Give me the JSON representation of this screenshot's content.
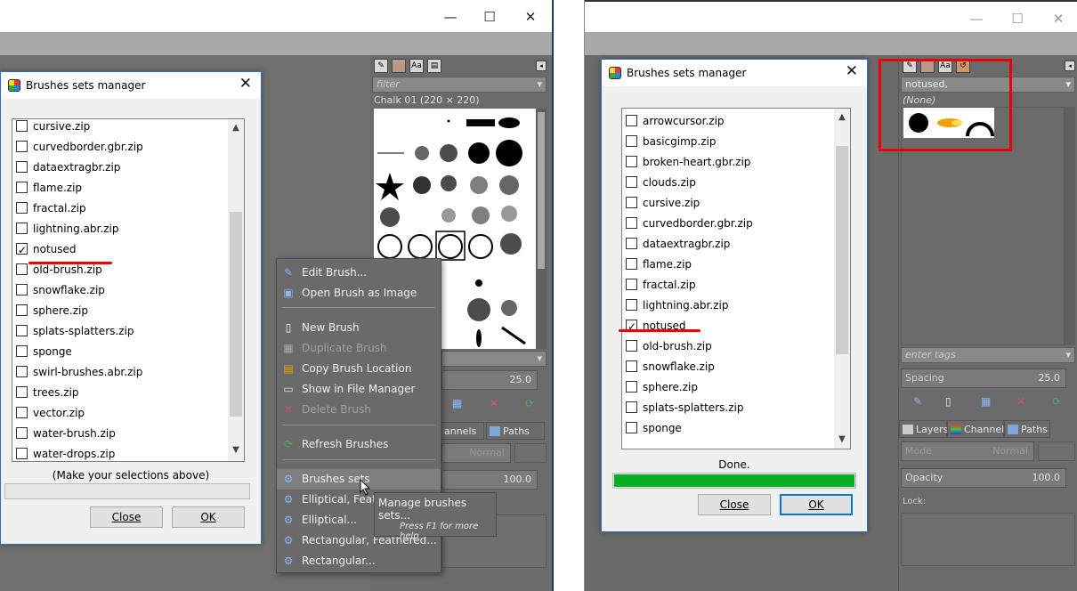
{
  "left": {
    "dialog": {
      "title": "Brushes sets manager",
      "items": [
        {
          "label": "cursive.zip",
          "checked": false
        },
        {
          "label": "curvedborder.gbr.zip",
          "checked": false
        },
        {
          "label": "dataextragbr.zip",
          "checked": false
        },
        {
          "label": "flame.zip",
          "checked": false
        },
        {
          "label": "fractal.zip",
          "checked": false
        },
        {
          "label": "lightning.abr.zip",
          "checked": false
        },
        {
          "label": "notused",
          "checked": true
        },
        {
          "label": "old-brush.zip",
          "checked": false
        },
        {
          "label": "snowflake.zip",
          "checked": false
        },
        {
          "label": "sphere.zip",
          "checked": false
        },
        {
          "label": "splats-splatters.zip",
          "checked": false
        },
        {
          "label": "sponge",
          "checked": false
        },
        {
          "label": "swirl-brushes.abr.zip",
          "checked": false
        },
        {
          "label": "trees.zip",
          "checked": false
        },
        {
          "label": "vector.zip",
          "checked": false
        },
        {
          "label": "water-brush.zip",
          "checked": false
        },
        {
          "label": "water-drops.zip",
          "checked": false
        }
      ],
      "status": "(Make your selections above)",
      "close_label": "Close",
      "ok_label": "OK"
    },
    "brushes_panel": {
      "filter_placeholder": "filter",
      "brush_name": "Chalk 01 (220 × 220)",
      "spacing_value": "25.0",
      "mode_label": "Normal",
      "opacity_value": "100.0",
      "tab_channels": "annels",
      "tab_paths": "Paths"
    },
    "context_menu": {
      "items": [
        {
          "label": "Edit Brush...",
          "icon": "pencil-icon",
          "disabled": false
        },
        {
          "label": "Open Brush as Image",
          "icon": "image-icon",
          "disabled": false
        },
        {
          "label": "New Brush",
          "icon": "new-document-icon",
          "disabled": false
        },
        {
          "label": "Duplicate Brush",
          "icon": "duplicate-icon",
          "disabled": true
        },
        {
          "label": "Copy Brush Location",
          "icon": "copy-location-icon",
          "disabled": false
        },
        {
          "label": "Show in File Manager",
          "icon": "file-manager-icon",
          "disabled": false
        },
        {
          "label": "Delete Brush",
          "icon": "delete-icon",
          "disabled": true
        },
        {
          "label": "Refresh Brushes",
          "icon": "refresh-icon",
          "disabled": false
        },
        {
          "label": "Brushes sets",
          "icon": "plugin-icon",
          "disabled": false
        },
        {
          "label": "Elliptical, Feathe",
          "icon": "plugin-icon",
          "disabled": false
        },
        {
          "label": "Elliptical...",
          "icon": "plugin-icon",
          "disabled": false
        },
        {
          "label": "Rectangular, Feathered...",
          "icon": "plugin-icon",
          "disabled": false
        },
        {
          "label": "Rectangular...",
          "icon": "plugin-icon",
          "disabled": false
        }
      ],
      "submenu_label": "Manage brushes sets...",
      "submenu_hint": "Press F1 for more help"
    }
  },
  "right": {
    "dialog": {
      "title": "Brushes sets manager",
      "items": [
        {
          "label": "arrowcursor.zip",
          "checked": false
        },
        {
          "label": "basicgimp.zip",
          "checked": false
        },
        {
          "label": "broken-heart.gbr.zip",
          "checked": false
        },
        {
          "label": "clouds.zip",
          "checked": false
        },
        {
          "label": "cursive.zip",
          "checked": false
        },
        {
          "label": "curvedborder.gbr.zip",
          "checked": false
        },
        {
          "label": "dataextragbr.zip",
          "checked": false
        },
        {
          "label": "flame.zip",
          "checked": false
        },
        {
          "label": "fractal.zip",
          "checked": false
        },
        {
          "label": "lightning.abr.zip",
          "checked": false
        },
        {
          "label": "notused",
          "checked": true
        },
        {
          "label": "old-brush.zip",
          "checked": false
        },
        {
          "label": "snowflake.zip",
          "checked": false
        },
        {
          "label": "sphere.zip",
          "checked": false
        },
        {
          "label": "splats-splatters.zip",
          "checked": false
        },
        {
          "label": "sponge",
          "checked": false
        }
      ],
      "status": "Done.",
      "progress": 1.0,
      "close_label": "Close",
      "ok_label": "OK"
    },
    "brushes_panel": {
      "tag_value": "notused,",
      "none_label": "(None)",
      "enter_tags_placeholder": "enter tags",
      "spacing_label": "Spacing",
      "spacing_value": "25.0",
      "tab_layers": "Layers",
      "tab_channels": "Channels",
      "tab_paths": "Paths",
      "mode_label": "Mode",
      "mode_value": "Normal",
      "opacity_label": "Opacity",
      "opacity_value": "100.0",
      "lock_label": "Lock:"
    }
  },
  "colors": {
    "annotation_red": "#e00000",
    "progress_green": "#06b025",
    "accent_blue": "#0078d7"
  }
}
